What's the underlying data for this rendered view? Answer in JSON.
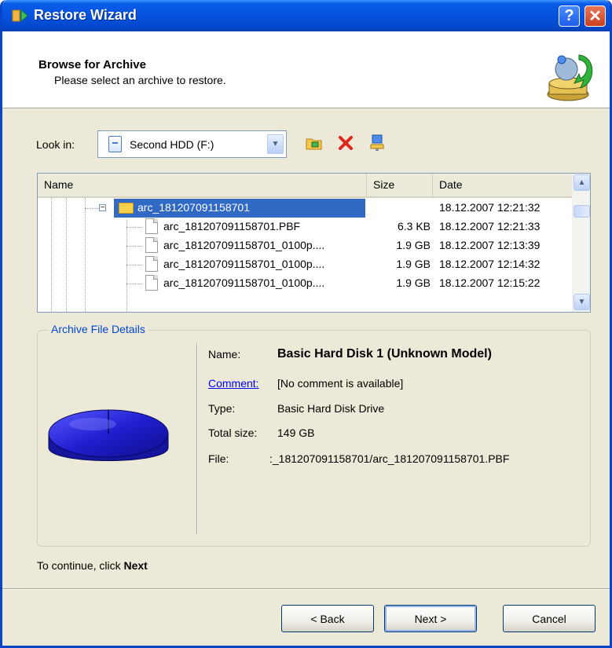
{
  "window": {
    "title": "Restore Wizard",
    "help_label": "?",
    "close_label": "✕"
  },
  "header": {
    "title": "Browse for Archive",
    "subtitle": "Please select an archive to restore."
  },
  "lookin": {
    "label": "Look in:",
    "selected": "Second HDD (F:)"
  },
  "list": {
    "columns": {
      "name": "Name",
      "size": "Size",
      "date": "Date"
    },
    "rows": [
      {
        "name": "arc_181207091158701",
        "size": "",
        "date": "18.12.2007 12:21:32"
      },
      {
        "name": "arc_181207091158701.PBF",
        "size": "6.3 KB",
        "date": "18.12.2007 12:21:33"
      },
      {
        "name": "arc_181207091158701_0100p....",
        "size": "1.9 GB",
        "date": "18.12.2007 12:13:39"
      },
      {
        "name": "arc_181207091158701_0100p....",
        "size": "1.9 GB",
        "date": "18.12.2007 12:14:32"
      },
      {
        "name": "arc_181207091158701_0100p....",
        "size": "1.9 GB",
        "date": "18.12.2007 12:15:22"
      }
    ]
  },
  "details": {
    "legend": "Archive File Details",
    "name_label": "Name:",
    "name_value": "Basic Hard Disk 1 (Unknown Model)",
    "comment_label": "Comment:",
    "comment_value": "[No comment is available]",
    "type_label": "Type:",
    "type_value": "Basic Hard Disk Drive",
    "size_label": "Total size:",
    "size_value": "149 GB",
    "file_label": "File:",
    "file_value": ":_181207091158701/arc_181207091158701.PBF"
  },
  "instruction": {
    "prefix": "To continue, click ",
    "emphasis": "Next"
  },
  "buttons": {
    "back": "< Back",
    "next": "Next >",
    "cancel": "Cancel"
  },
  "colors": {
    "titlebar": "#0553e0",
    "selection": "#316ac5",
    "link": "#0000ff",
    "legend": "#0046d5",
    "disk": "#1f1fd0"
  }
}
